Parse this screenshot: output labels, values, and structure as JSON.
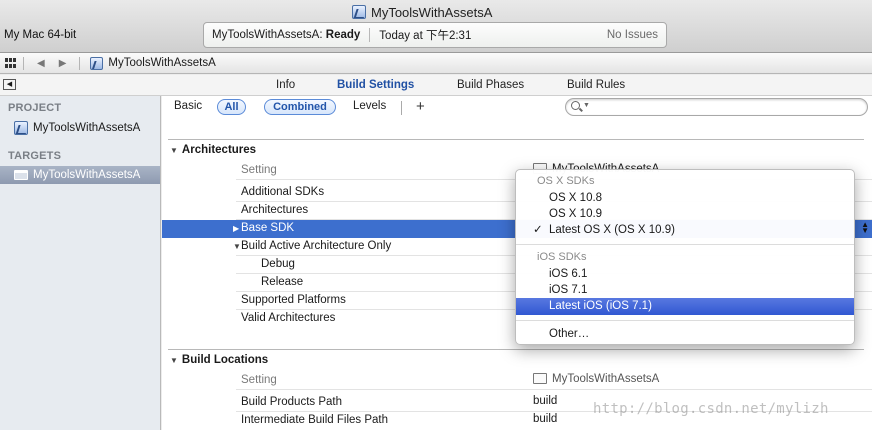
{
  "window": {
    "title": "MyToolsWithAssetsA",
    "scheme": "My Mac 64-bit",
    "activity_project": "MyToolsWithAssetsA:",
    "activity_status": "Ready",
    "activity_time": "Today at 下午2:31",
    "issues": "No Issues"
  },
  "jumpbar": {
    "project": "MyToolsWithAssetsA"
  },
  "tabs": [
    "Info",
    "Build Settings",
    "Build Phases",
    "Build Rules"
  ],
  "sidebar": {
    "project_header": "PROJECT",
    "project_item": "MyToolsWithAssetsA",
    "targets_header": "TARGETS",
    "target_item": "MyToolsWithAssetsA"
  },
  "filters": {
    "basic": "Basic",
    "all": "All",
    "combined": "Combined",
    "levels": "Levels",
    "add": "+"
  },
  "architectures": {
    "title": "Architectures",
    "setting_header": "Setting",
    "target_header": "MyToolsWithAssetsA",
    "rows": [
      "Additional SDKs",
      "Architectures",
      "Base SDK",
      "Build Active Architecture Only",
      "Debug",
      "Release",
      "Supported Platforms",
      "Valid Architectures"
    ],
    "ghost_value": "Latest OS X (OS X 10.9)"
  },
  "build_locations": {
    "title": "Build Locations",
    "setting_header": "Setting",
    "target_header": "MyToolsWithAssetsA",
    "rows": [
      {
        "name": "Build Products Path",
        "value": "build"
      },
      {
        "name": "Intermediate Build Files Path",
        "value": "build"
      }
    ]
  },
  "menu": {
    "osx_header": "OS X SDKs",
    "osx_items": [
      "OS X 10.8",
      "OS X 10.9",
      "Latest OS X (OS X 10.9)"
    ],
    "ios_header": "iOS SDKs",
    "ios_items": [
      "iOS 6.1",
      "iOS 7.1",
      "Latest iOS (iOS 7.1)"
    ],
    "other": "Other…",
    "check": "✓"
  },
  "watermark": "http://blog.csdn.net/mylizh",
  "colors": {
    "selection": "#3d6fce",
    "menu_highlight": "#3158d2",
    "tab_active": "#2151a4"
  }
}
